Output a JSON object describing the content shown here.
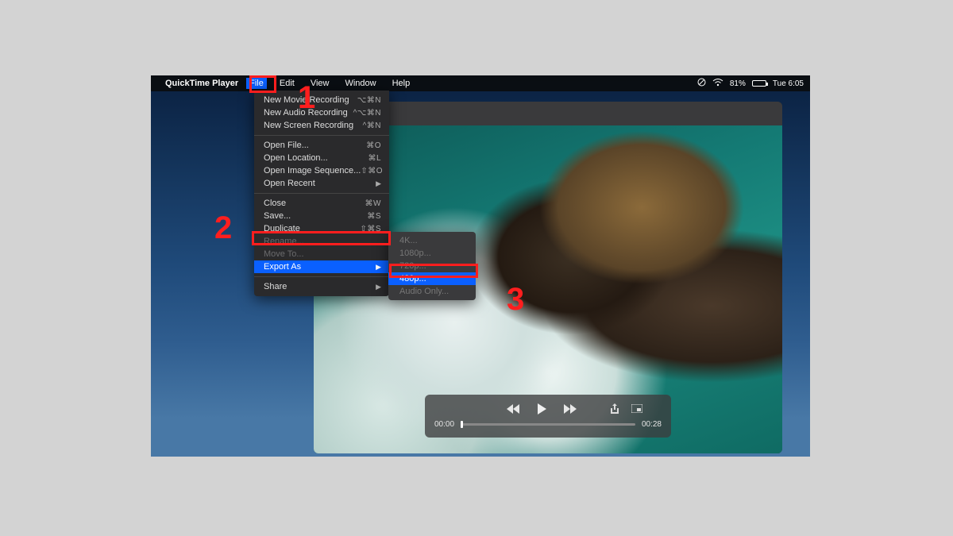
{
  "menubar": {
    "app_name": "QuickTime Player",
    "items": [
      "File",
      "Edit",
      "View",
      "Window",
      "Help"
    ],
    "open_index": 0,
    "right": {
      "battery_pct": "81%",
      "clock": "Tue 6:05"
    }
  },
  "file_menu": {
    "groups": [
      [
        {
          "label": "New Movie Recording",
          "shortcut": "⌥⌘N"
        },
        {
          "label": "New Audio Recording",
          "shortcut": "^⌥⌘N"
        },
        {
          "label": "New Screen Recording",
          "shortcut": "^⌘N"
        }
      ],
      [
        {
          "label": "Open File...",
          "shortcut": "⌘O"
        },
        {
          "label": "Open Location...",
          "shortcut": "⌘L"
        },
        {
          "label": "Open Image Sequence...",
          "shortcut": "⇧⌘O"
        },
        {
          "label": "Open Recent",
          "submenu": true
        }
      ],
      [
        {
          "label": "Close",
          "shortcut": "⌘W"
        },
        {
          "label": "Save...",
          "shortcut": "⌘S"
        },
        {
          "label": "Duplicate",
          "shortcut": "⇧⌘S"
        },
        {
          "label": "Rename...",
          "disabled": true
        },
        {
          "label": "Move To...",
          "disabled": true
        },
        {
          "label": "Export As",
          "submenu": true,
          "selected": true
        }
      ],
      [
        {
          "label": "Share",
          "submenu": true
        }
      ]
    ]
  },
  "export_submenu": {
    "items": [
      {
        "label": "4K...",
        "disabled": true
      },
      {
        "label": "1080p...",
        "disabled": true
      },
      {
        "label": "720p...",
        "disabled": true
      },
      {
        "label": "480p...",
        "selected": true
      },
      {
        "label": "Audio Only...",
        "disabled": true
      }
    ]
  },
  "player": {
    "current_time": "00:00",
    "duration": "00:28"
  },
  "annotations": {
    "n1": "1",
    "n2": "2",
    "n3": "3"
  }
}
